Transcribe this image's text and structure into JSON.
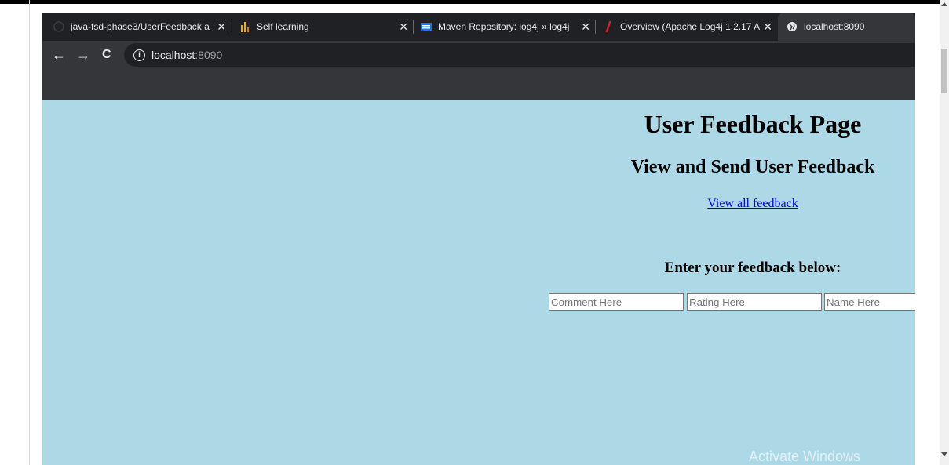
{
  "browser": {
    "tabs": [
      {
        "title": "java-fsd-phase3/UserFeedback a",
        "favicon": "github-icon",
        "close": "✕"
      },
      {
        "title": "Self learning",
        "favicon": "chart-icon",
        "close": "✕"
      },
      {
        "title": "Maven Repository: log4j » log4j",
        "favicon": "maven-icon",
        "close": "✕"
      },
      {
        "title": "Overview (Apache Log4j 1.2.17 A",
        "favicon": "feather-icon",
        "close": "✕"
      },
      {
        "title": "localhost:8090",
        "favicon": "globe-icon"
      }
    ],
    "nav": {
      "back": "←",
      "forward": "→",
      "reload": "C"
    },
    "address": {
      "host": "localhost",
      "port": ":8090",
      "info_icon": "i"
    }
  },
  "page": {
    "title": "User Feedback Page",
    "subtitle": "View and Send User Feedback",
    "link": "View all feedback",
    "form_heading": "Enter your feedback below:",
    "inputs": {
      "comment_placeholder": "Comment Here",
      "rating_placeholder": "Rating Here",
      "name_placeholder": "Name Here"
    },
    "background_color": "#add8e6"
  },
  "os": {
    "watermark": "Activate Windows"
  }
}
